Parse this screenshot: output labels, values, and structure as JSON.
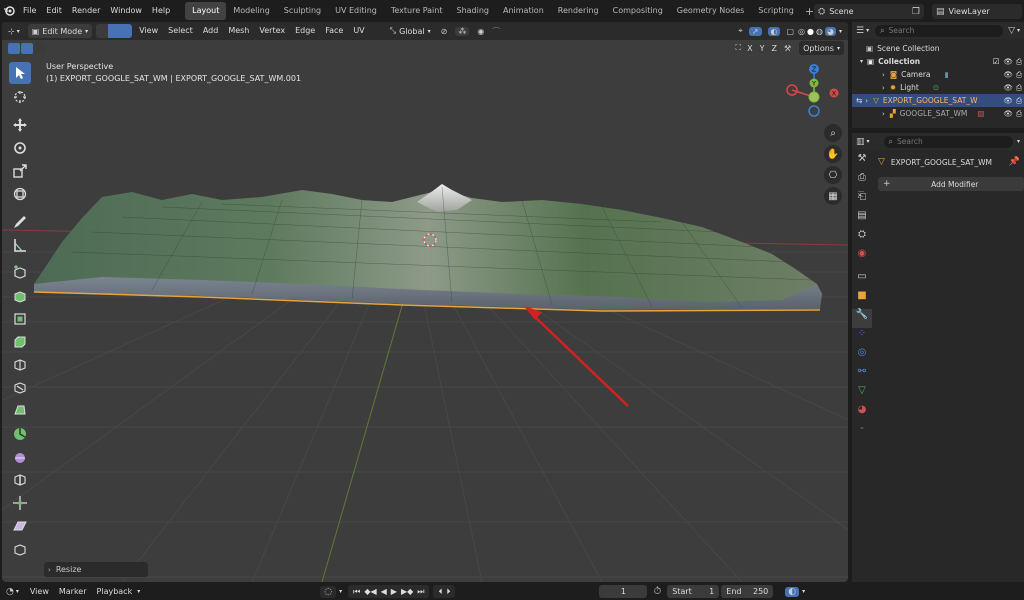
{
  "menu": {
    "items": [
      "File",
      "Edit",
      "Render",
      "Window",
      "Help"
    ],
    "workspaces": [
      "Layout",
      "Modeling",
      "Sculpting",
      "UV Editing",
      "Texture Paint",
      "Shading",
      "Animation",
      "Rendering",
      "Compositing",
      "Geometry Nodes",
      "Scripting"
    ],
    "active_workspace": "Layout",
    "scene_name": "Scene",
    "view_layer": "ViewLayer"
  },
  "viewport": {
    "mode_label": "Edit Mode",
    "header_menus": [
      "View",
      "Select",
      "Add",
      "Mesh",
      "Vertex",
      "Edge",
      "Face",
      "UV"
    ],
    "transform_orientation": "Global",
    "axes": [
      "X",
      "Y",
      "Z"
    ],
    "options_label": "Options",
    "overlay_title": "User Perspective",
    "overlay_subtitle": "(1) EXPORT_GOOGLE_SAT_WM | EXPORT_GOOGLE_SAT_WM.001",
    "gizmo_labels": {
      "z": "Z",
      "y": "Y",
      "x": "X"
    },
    "operator_panel": "Resize"
  },
  "outliner": {
    "search_placeholder": "Search",
    "items": [
      {
        "label": "Scene Collection",
        "level": 0
      },
      {
        "label": "Collection",
        "level": 1
      },
      {
        "label": "Camera",
        "level": 2
      },
      {
        "label": "Light",
        "level": 2
      },
      {
        "label": "EXPORT_GOOGLE_SAT_WM",
        "level": 2,
        "selected": true
      },
      {
        "label": "GOOGLE_SAT_WM",
        "level": 2
      }
    ]
  },
  "properties": {
    "search_placeholder": "Search",
    "object_name": "EXPORT_GOOGLE_SAT_WM",
    "add_modifier_label": "Add Modifier"
  },
  "statusbar": {
    "menus": [
      "View",
      "Marker",
      "Playback"
    ],
    "current_frame": "1",
    "start_label": "Start",
    "start_value": "1",
    "end_label": "End",
    "end_value": "250"
  },
  "colors": {
    "accent": "#4772b3",
    "arrow": "#d42020",
    "selection": "#e8a53a",
    "axis_x": "#d44a4a",
    "axis_y": "#7fb83d",
    "axis_z": "#3b7fd9"
  }
}
